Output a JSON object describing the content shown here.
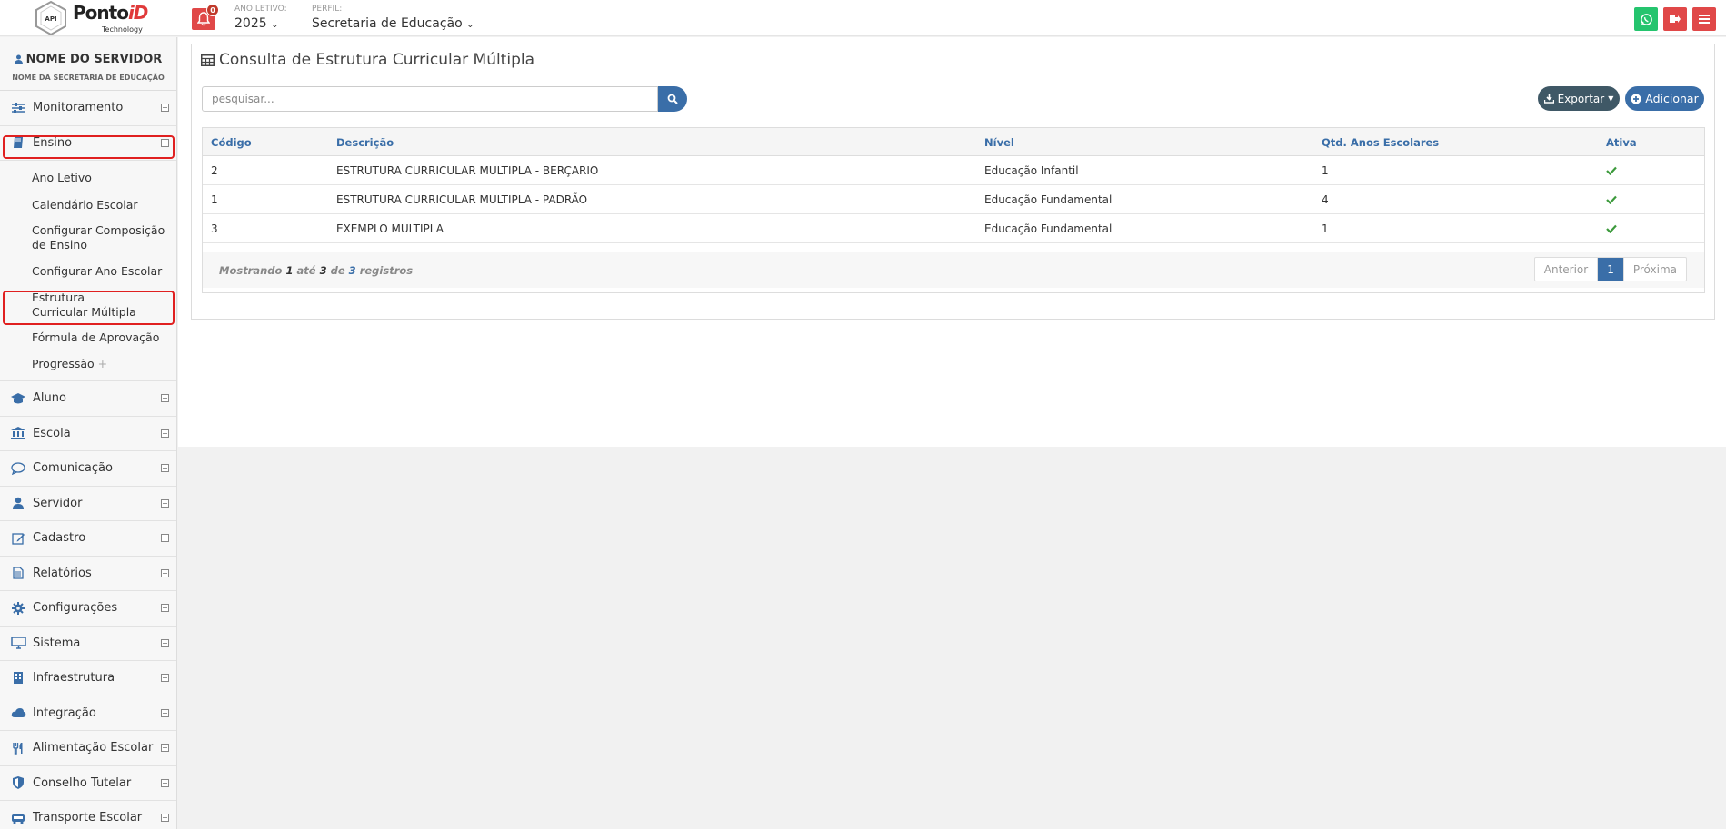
{
  "header": {
    "logo_main": "Ponto",
    "logo_accent": "iD",
    "logo_sub": "Technology",
    "logo_badge": "API",
    "notifications_count": "0",
    "ano_letivo_label": "ANO LETIVO:",
    "ano_letivo_value": "2025",
    "perfil_label": "PERFIL:",
    "perfil_value": "Secretaria de Educação",
    "colors": {
      "whatsapp": "#25c46e",
      "logout": "#e04848",
      "menu": "#e04848",
      "bell": "#e04848"
    }
  },
  "sidebar": {
    "user_name": "NOME DO SERVIDOR",
    "user_sub": "NOME DA SECRETARIA DE EDUCAÇÃO",
    "items": [
      {
        "label": "Monitoramento",
        "icon": "sliders-icon"
      },
      {
        "label": "Ensino",
        "icon": "book-icon",
        "expanded": true
      },
      {
        "label": "Aluno",
        "icon": "graduation-cap-icon"
      },
      {
        "label": "Escola",
        "icon": "bank-icon"
      },
      {
        "label": "Comunicação",
        "icon": "chat-bubble-icon"
      },
      {
        "label": "Servidor",
        "icon": "user-icon"
      },
      {
        "label": "Cadastro",
        "icon": "edit-icon"
      },
      {
        "label": "Relatórios",
        "icon": "file-text-icon"
      },
      {
        "label": "Configurações",
        "icon": "gear-icon"
      },
      {
        "label": "Sistema",
        "icon": "monitor-icon"
      },
      {
        "label": "Infraestrutura",
        "icon": "building-icon"
      },
      {
        "label": "Integração",
        "icon": "cloud-icon"
      },
      {
        "label": "Alimentação Escolar",
        "icon": "cutlery-icon"
      },
      {
        "label": "Conselho Tutelar",
        "icon": "shield-icon"
      },
      {
        "label": "Transporte Escolar",
        "icon": "bus-icon"
      }
    ],
    "ensino_sub": [
      "Ano Letivo",
      "Calendário Escolar",
      "Configurar Composição de Ensino",
      "Configurar Ano Escolar",
      "Estrutura Curricular Múltipla",
      "Fórmula de Aprovação",
      "Progressão"
    ]
  },
  "main": {
    "title": "Consulta de Estrutura Curricular Múltipla",
    "search_placeholder": "pesquisar...",
    "export_label": "Exportar",
    "add_label": "Adicionar",
    "columns": [
      "Código",
      "Descrição",
      "Nível",
      "Qtd. Anos Escolares",
      "Ativa"
    ],
    "rows": [
      {
        "codigo": "2",
        "descricao": "ESTRUTURA CURRICULAR MULTIPLA - BERÇARIO",
        "nivel": "Educação Infantil",
        "qtd": "1",
        "ativa": true
      },
      {
        "codigo": "1",
        "descricao": "ESTRUTURA CURRICULAR MULTIPLA - PADRÃO",
        "nivel": "Educação Fundamental",
        "qtd": "4",
        "ativa": true
      },
      {
        "codigo": "3",
        "descricao": "EXEMPLO MULTIPLA",
        "nivel": "Educação Fundamental",
        "qtd": "1",
        "ativa": true
      }
    ],
    "footer": {
      "showing_prefix": "Mostrando",
      "from": "1",
      "ate": "até",
      "to": "3",
      "de": "de",
      "total": "3",
      "registros": "registros"
    },
    "pager": {
      "prev": "Anterior",
      "current": "1",
      "next": "Próxima"
    }
  }
}
